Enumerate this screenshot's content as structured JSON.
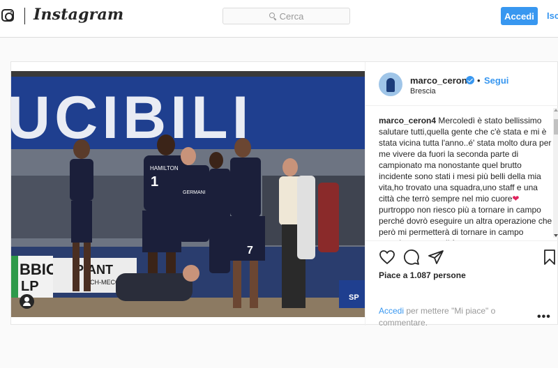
{
  "topbar": {
    "logo_icon": "instagram-camera-icon",
    "wordmark": "Instagram",
    "search_placeholder": "Cerca",
    "login_label": "Accedi",
    "signup_label": "Iscriviti",
    "accent_color": "#3897f0"
  },
  "post": {
    "author": {
      "username": "marco_ceron4",
      "verified": true,
      "follow_label": "Segui",
      "separator": "•",
      "location": "Brescia"
    },
    "photo": {
      "banner_text": "UCIBILI",
      "sponsor_left_line1": "BBIO",
      "sponsor_left_line2": "LP",
      "sponsor_right_line1": "PIANT",
      "sponsor_right_line2": "RICH-MECC",
      "floor_logo": "SP",
      "jersey_name": "HAMILTON",
      "jersey_number_1": "1",
      "jersey_number_2": "7",
      "jersey_sponsor": "GERMANI"
    },
    "caption": {
      "username": "marco_ceron4",
      "text_part1": "Mercoledì è stato bellissimo salutare tutti,quella gente che c'è stata e mi è stata vicina tutta l'anno..é' stata molto dura per me vivere da fuori la seconda parte di campionato ma nonostante quel brutto incidente sono stati i mesi più belli della mia vita,ho trovato una squadra,uno staff e una città che terrò sempre nel mio cuore",
      "heart": "❤",
      "text_part2": "purtroppo non riesco più a tornare in campo perché dovrò eseguire un altra operazione che però mi permetterà di tornare in campo prossimo anno e di fare"
    },
    "actions": {
      "like_icon": "heart-outline-icon",
      "comment_icon": "comment-bubble-icon",
      "share_icon": "share-paper-plane-icon",
      "save_icon": "bookmark-icon",
      "likes_text": "Piace a 1.087 persone",
      "login_link": "Accedi",
      "login_hint": "per mettere \"Mi piace\" o commentare.",
      "more_label": "•••"
    }
  }
}
